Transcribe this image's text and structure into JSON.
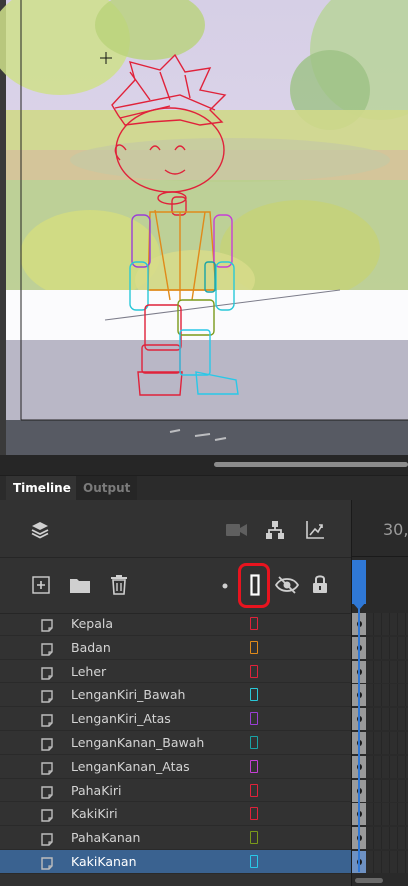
{
  "tabs": [
    {
      "label": "Timeline"
    },
    {
      "label": "Output"
    }
  ],
  "toolbar": {
    "icons": [
      "layers-icon",
      "camera-icon",
      "hierarchy-icon",
      "graph-icon"
    ],
    "layer_tools": [
      "new-layer-icon",
      "new-folder-icon",
      "delete-icon",
      "dot-icon",
      "outline-icon",
      "eye-icon",
      "lock-icon"
    ]
  },
  "frame_ruler": {
    "number_label": "30,"
  },
  "layers": [
    {
      "name": "Kepala",
      "outline_color": "#e0223a"
    },
    {
      "name": "Badan",
      "outline_color": "#e08a1a"
    },
    {
      "name": "Leher",
      "outline_color": "#e0223a"
    },
    {
      "name": "LenganKiri_Bawah",
      "outline_color": "#29c8d8"
    },
    {
      "name": "LenganKiri_Atas",
      "outline_color": "#9a3fd6"
    },
    {
      "name": "LenganKanan_Bawah",
      "outline_color": "#19a3a6"
    },
    {
      "name": "LenganKanan_Atas",
      "outline_color": "#c63fd6"
    },
    {
      "name": "PahaKiri",
      "outline_color": "#e0223a"
    },
    {
      "name": "KakiKiri",
      "outline_color": "#e0223a"
    },
    {
      "name": "PahaKanan",
      "outline_color": "#7a9a1a"
    },
    {
      "name": "KakiKanan",
      "outline_color": "#29c8e8",
      "selected": true
    }
  ],
  "colors": {
    "accent": "#2f78d6",
    "highlight": "#e8141f",
    "selected_row": "#3a6290"
  }
}
